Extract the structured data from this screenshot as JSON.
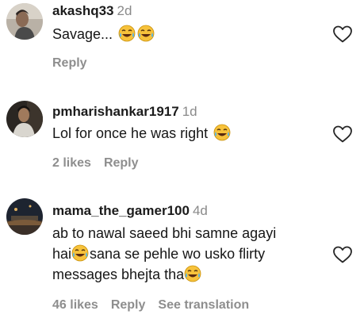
{
  "comments": [
    {
      "username": "akashq33",
      "time": "2d",
      "text_lines": [
        "Savage... "
      ],
      "likes": "",
      "reply_label": "Reply",
      "see_translation": ""
    },
    {
      "username": "pmharishankar1917",
      "time": "1d",
      "text_lines": [
        "Lol for once he was right "
      ],
      "likes": "2 likes",
      "reply_label": "Reply",
      "see_translation": ""
    },
    {
      "username": "mama_the_gamer100",
      "time": "4d",
      "text_lines": [
        "ab to nawal saeed bhi samne agayi",
        "hai",
        "sana se pehle wo usko flirty",
        "messages bhejta tha"
      ],
      "likes": "46 likes",
      "reply_label": "Reply",
      "see_translation": "See translation"
    }
  ],
  "icons": {
    "like": "heart-outline-icon",
    "emoji": "face-with-tears-of-joy-icon"
  },
  "colors": {
    "secondary_text": "#8e8e8e",
    "emoji_face": "#f7c23b"
  }
}
